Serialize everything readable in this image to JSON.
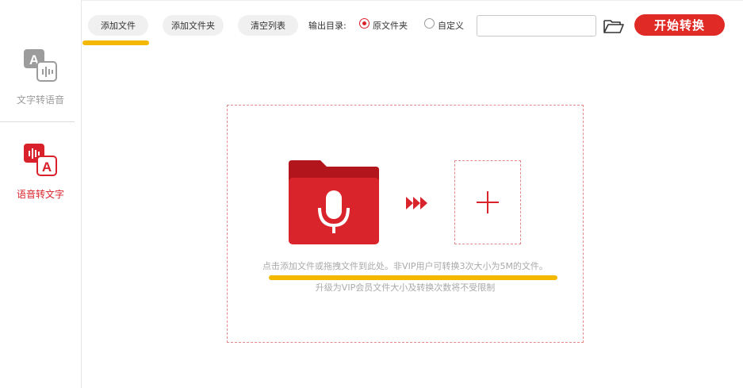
{
  "sidebar": {
    "items": [
      {
        "label": "文字转语音",
        "icon": "text-to-speech-icon",
        "active": false
      },
      {
        "label": "语音转文字",
        "icon": "speech-to-text-icon",
        "active": true
      }
    ]
  },
  "toolbar": {
    "add_file": "添加文件",
    "add_folder": "添加文件夹",
    "clear_list": "清空列表",
    "output_label": "输出目录:",
    "option_original": "原文件夹",
    "option_custom": "自定义",
    "selected_option": "原文件夹",
    "path_value": "",
    "start": "开始转换"
  },
  "dropzone": {
    "hint_line1": "点击添加文件或拖拽文件到此处。非VIP用户可转换3次大小为5M的文件。",
    "hint_line2": "升级为VIP会员文件大小及转换次数将不受限制"
  },
  "colors": {
    "accent_red": "#e02a26",
    "highlight_yellow": "#f5b800",
    "dashed_border": "#e2888a"
  }
}
